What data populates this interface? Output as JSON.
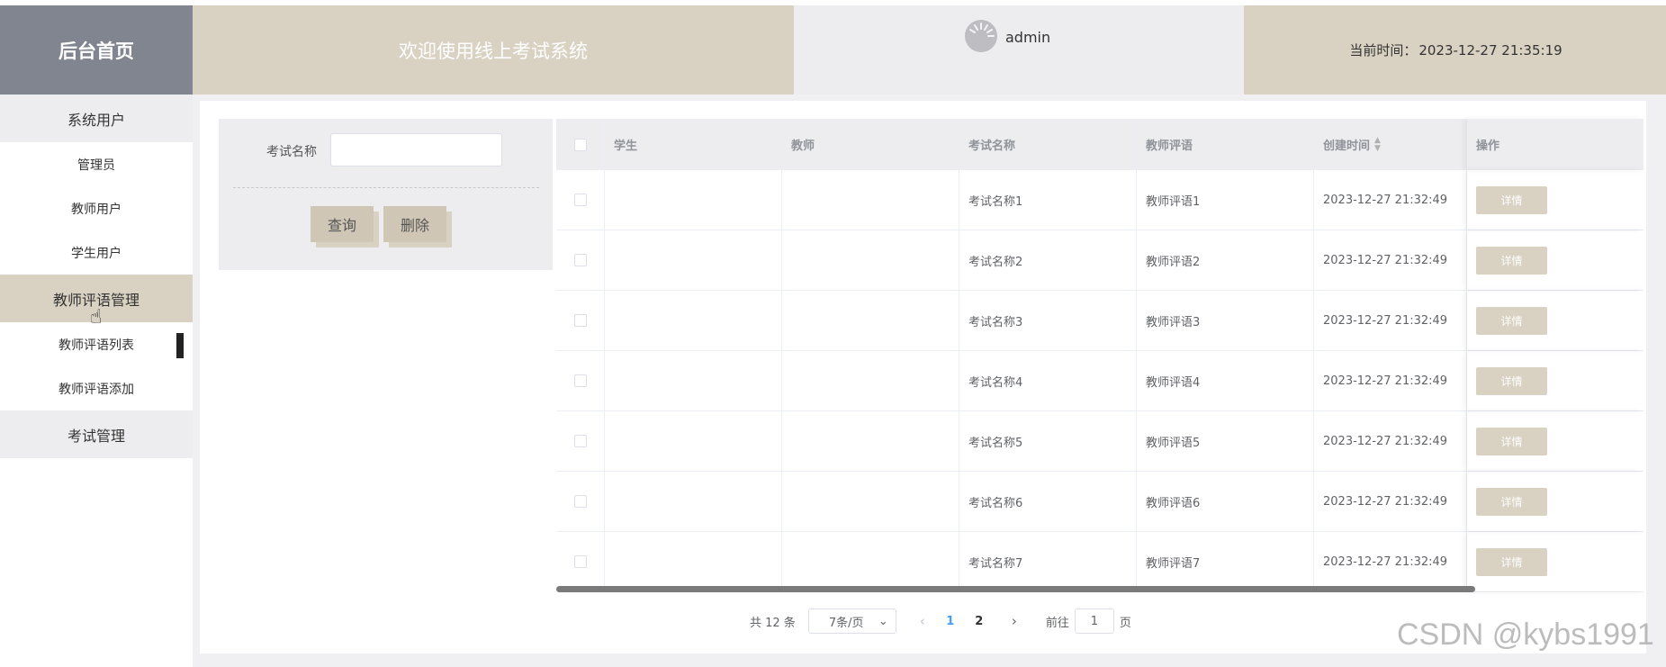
{
  "header": {
    "brand": "后台首页",
    "welcome": "欢迎使用线上考试系统",
    "username": "admin",
    "time_label": "当前时间：",
    "time_value": "2023-12-27 21:35:19"
  },
  "sidebar": {
    "groups": [
      {
        "label": "系统用户",
        "items": [
          "管理员",
          "教师用户",
          "学生用户"
        ]
      },
      {
        "label": "教师评语管理",
        "items": [
          "教师评语列表",
          "教师评语添加"
        ]
      },
      {
        "label": "考试管理",
        "items": []
      }
    ]
  },
  "search": {
    "label": "考试名称",
    "value": "",
    "query_button": "查询",
    "delete_button": "删除"
  },
  "table": {
    "columns": [
      "学生",
      "教师",
      "考试名称",
      "教师评语",
      "创建时间",
      "操作"
    ],
    "rows": [
      {
        "student": "",
        "teacher": "",
        "exam": "考试名称1",
        "comment": "教师评语1",
        "created": "2023-12-27 21:32:49",
        "action": "详情"
      },
      {
        "student": "",
        "teacher": "",
        "exam": "考试名称2",
        "comment": "教师评语2",
        "created": "2023-12-27 21:32:49",
        "action": "详情"
      },
      {
        "student": "",
        "teacher": "",
        "exam": "考试名称3",
        "comment": "教师评语3",
        "created": "2023-12-27 21:32:49",
        "action": "详情"
      },
      {
        "student": "",
        "teacher": "",
        "exam": "考试名称4",
        "comment": "教师评语4",
        "created": "2023-12-27 21:32:49",
        "action": "详情"
      },
      {
        "student": "",
        "teacher": "",
        "exam": "考试名称5",
        "comment": "教师评语5",
        "created": "2023-12-27 21:32:49",
        "action": "详情"
      },
      {
        "student": "",
        "teacher": "",
        "exam": "考试名称6",
        "comment": "教师评语6",
        "created": "2023-12-27 21:32:49",
        "action": "详情"
      },
      {
        "student": "",
        "teacher": "",
        "exam": "考试名称7",
        "comment": "教师评语7",
        "created": "2023-12-27 21:32:49",
        "action": "详情"
      }
    ]
  },
  "pagination": {
    "total": "共 12 条",
    "page_size": "7条/页",
    "pages": [
      "1",
      "2"
    ],
    "current_page": "1",
    "goto_label": "前往",
    "goto_value": "1",
    "page_suffix": "页"
  },
  "watermark": "CSDN @kybs1991",
  "colors": {
    "brand_bg": "#808590",
    "accent_beige": "#d9d1c2",
    "light_gray": "#ededef",
    "current_page": "#409eff"
  },
  "icons": {
    "avatar": "avatar-icon",
    "sort": "sort-icon",
    "prev": "chevron-left-icon",
    "next": "chevron-right-icon",
    "dropdown": "chevron-down-icon",
    "cursor": "hand-pointer-icon"
  }
}
